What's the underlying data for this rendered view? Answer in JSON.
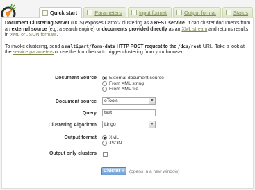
{
  "tabs": [
    {
      "label": "Quick start",
      "icon": "home-icon"
    },
    {
      "label": "Parameters",
      "icon": "parameters-icon"
    },
    {
      "label": "Input format",
      "icon": "document-icon"
    },
    {
      "label": "Output format",
      "icon": "document-icon"
    },
    {
      "label": "Status",
      "icon": "info-icon"
    }
  ],
  "intro": {
    "p1_b1": "Document Clustering Server",
    "p1_t1": " (DCS) exposes Carrot2 clustering as a ",
    "p1_b2": "REST service",
    "p1_t2": ". It can cluster documents from an ",
    "p1_b3": "external source",
    "p1_t3": " (e.g. a search engine) or ",
    "p1_b4": "documents provided directly",
    "p1_t4": " as an ",
    "p1_l1": "XML stream",
    "p1_t5": " and returns results in ",
    "p1_l2": "XML or JSON formats",
    "p1_t6": ".",
    "p2_t1": "To invoke clustering, send a ",
    "p2_c1": "multipart/form-data",
    "p2_b1": " HTTP POST request to the ",
    "p2_c2": "/dcs/rest",
    "p2_t2": " URL. Take a look at the ",
    "p2_l1": "service parameters",
    "p2_t3": " or use the form below to trigger clustering from your browser."
  },
  "form": {
    "document_source_label": "Document Source",
    "source_options": [
      "External document source",
      "From XML string",
      "From XML file"
    ],
    "document_source2_label": "Document source",
    "document_source_value": "eTools",
    "query_label": "Query",
    "query_value": "test",
    "algorithm_label": "Clustering Algorithm",
    "algorithm_value": "Lingo",
    "output_format_label": "Output format",
    "output_options": [
      "XML",
      "JSON"
    ],
    "output_only_clusters_label": "Output only clusters",
    "submit_label": "Cluster »",
    "submit_hint": "(opens in a new window)"
  },
  "colors": {
    "accent": "#7c8850",
    "button": "#6f9fd4",
    "logo_orange": "#f08a1c"
  }
}
